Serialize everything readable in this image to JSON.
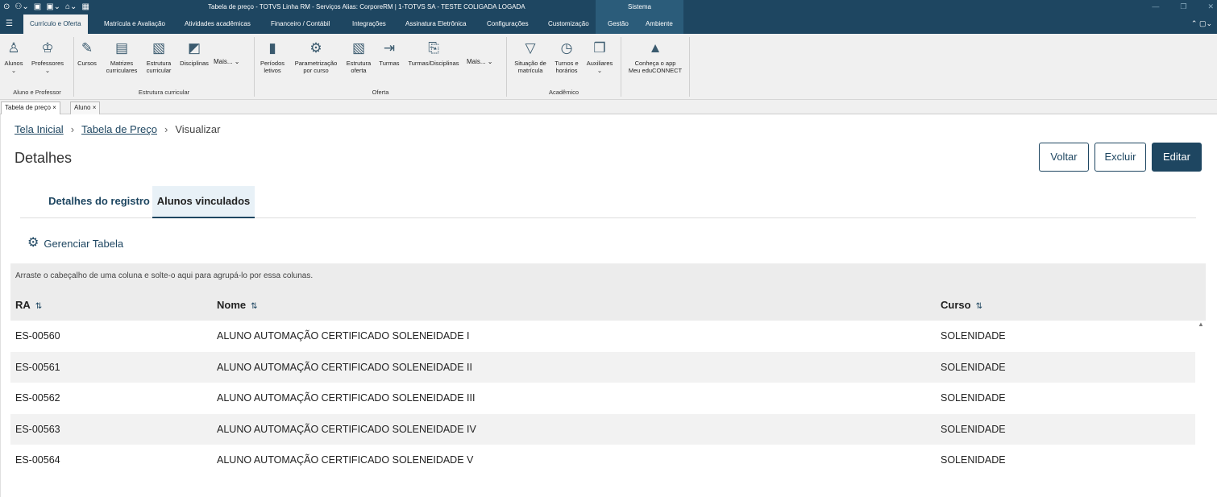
{
  "titlebar": {
    "title": "Tabela de preço - TOTVS Linha RM - Serviços  Alias: CorporeRM | 1-TOTVS SA - TESTE COLIGADA LOGADA",
    "context_label": "Sistema"
  },
  "ribbon_tabs": [
    "Currículo e Oferta",
    "Matrícula e Avaliação",
    "Atividades acadêmicas",
    "Financeiro / Contábil",
    "Integrações",
    "Assinatura Eletrônica",
    "Configurações",
    "Customização",
    "Gestão",
    "Ambiente"
  ],
  "ribbon": {
    "alunos": "Alunos",
    "professores": "Professores",
    "group1": "Aluno e Professor",
    "cursos": "Cursos",
    "matrizes_1": "Matrizes",
    "matrizes_2": "curriculares",
    "estrutura_1": "Estrutura",
    "estrutura_2": "curricular",
    "disciplinas": "Disciplinas",
    "mais1": "Mais...",
    "group2": "Estrutura curricular",
    "periodos_1": "Períodos",
    "periodos_2": "letivos",
    "param_1": "Parametrização",
    "param_2": "por curso",
    "estoferta_1": "Estrutura",
    "estoferta_2": "oferta",
    "turmas": "Turmas",
    "turmasdisc": "Turmas/Disciplinas",
    "mais2": "Mais...",
    "group3": "Oferta",
    "situacao_1": "Situação de",
    "situacao_2": "matrícula",
    "turnos_1": "Turnos e",
    "turnos_2": "horários",
    "auxiliares": "Auxiliares",
    "group4": "Acadêmico",
    "conheca_1": "Conheça o app",
    "conheca_2": "Meu eduCONNECT"
  },
  "doc_tabs": [
    "Tabela de preço",
    "Aluno"
  ],
  "breadcrumb": {
    "home": "Tela Inicial",
    "parent": "Tabela de Preço",
    "current": "Visualizar"
  },
  "page_title": "Detalhes",
  "actions": {
    "voltar": "Voltar",
    "excluir": "Excluir",
    "editar": "Editar"
  },
  "tabs": {
    "detalhes": "Detalhes do registro",
    "alunos": "Alunos vinculados"
  },
  "gerenciar": "Gerenciar Tabela",
  "group_hint": "Arraste o cabeçalho de uma coluna e solte-o aqui para agrupá-lo por essa colunas.",
  "columns": {
    "ra": "RA",
    "nome": "Nome",
    "curso": "Curso"
  },
  "rows": [
    {
      "ra": "ES-00560",
      "nome": "ALUNO AUTOMAÇÃO CERTIFICADO SOLENEIDADE I",
      "curso": "SOLENIDADE"
    },
    {
      "ra": "ES-00561",
      "nome": "ALUNO AUTOMAÇÃO CERTIFICADO SOLENEIDADE II",
      "curso": "SOLENIDADE"
    },
    {
      "ra": "ES-00562",
      "nome": "ALUNO AUTOMAÇÃO CERTIFICADO SOLENEIDADE III",
      "curso": "SOLENIDADE"
    },
    {
      "ra": "ES-00563",
      "nome": "ALUNO AUTOMAÇÃO CERTIFICADO SOLENEIDADE IV",
      "curso": "SOLENIDADE"
    },
    {
      "ra": "ES-00564",
      "nome": "ALUNO AUTOMAÇÃO CERTIFICADO SOLENEIDADE V",
      "curso": "SOLENIDADE"
    }
  ]
}
